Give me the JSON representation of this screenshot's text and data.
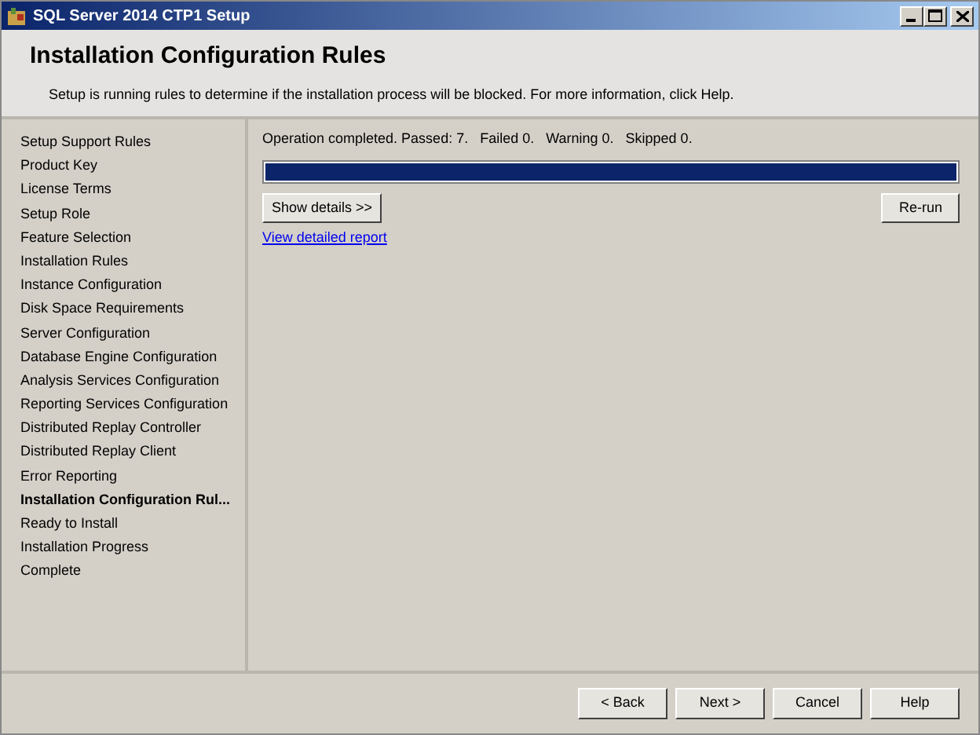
{
  "window": {
    "title": "SQL Server 2014 CTP1 Setup"
  },
  "header": {
    "title": "Installation Configuration Rules",
    "description": "Setup is running rules to determine if the installation process will be blocked. For more information, click Help."
  },
  "steps": [
    {
      "label": "Setup Support Rules",
      "selected": false
    },
    {
      "label": "Product Key",
      "selected": false
    },
    {
      "label": "License Terms",
      "selected": false
    },
    {
      "label": "Setup Role",
      "selected": false
    },
    {
      "label": "Feature Selection",
      "selected": false
    },
    {
      "label": "Installation Rules",
      "selected": false
    },
    {
      "label": "Instance Configuration",
      "selected": false
    },
    {
      "label": "Disk Space Requirements",
      "selected": false
    },
    {
      "label": "Server Configuration",
      "selected": false
    },
    {
      "label": "Database Engine Configuration",
      "selected": false
    },
    {
      "label": "Analysis Services Configuration",
      "selected": false
    },
    {
      "label": "Reporting Services Configuration",
      "selected": false
    },
    {
      "label": "Distributed Replay Controller",
      "selected": false
    },
    {
      "label": "Distributed Replay Client",
      "selected": false
    },
    {
      "label": "Error Reporting",
      "selected": false
    },
    {
      "label": "Installation Configuration Rul...",
      "selected": true
    },
    {
      "label": "Ready to Install",
      "selected": false
    },
    {
      "label": "Installation Progress",
      "selected": false
    },
    {
      "label": "Complete",
      "selected": false
    }
  ],
  "status": "Operation completed. Passed: 7.   Failed 0.   Warning 0.   Skipped 0.",
  "progress": {
    "level": 1
  },
  "show_details_button": "Show details >>",
  "rerun_button": "Re-run",
  "report_link": "View detailed report",
  "footer_buttons": [
    "< Back",
    "Next >",
    "Cancel",
    "Help"
  ]
}
